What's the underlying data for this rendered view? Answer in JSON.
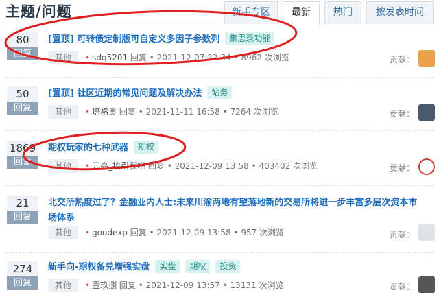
{
  "header": {
    "title": "主题/问题",
    "tabs": [
      {
        "label": "新手专区",
        "active": false
      },
      {
        "label": "最新",
        "active": true
      },
      {
        "label": "热门",
        "active": false
      },
      {
        "label": "按发表时间",
        "active": false
      }
    ]
  },
  "labels": {
    "reply": "回复",
    "contrib": "贡献：",
    "views_suffix": "次浏览",
    "reply_word": "回复"
  },
  "posts": [
    {
      "count": "80",
      "title": "[置顶] 可转债定制版可自定义多因子参数列",
      "tags": [
        "集思录功能"
      ],
      "category": "其他",
      "author": "sdq5201",
      "time": "2021-12-07 22:34",
      "views": "8962",
      "avatar_color": "#e9a14b"
    },
    {
      "count": "50",
      "title": "[置顶] 社区近期的常见问题及解决办法",
      "tags": [
        "站务"
      ],
      "category": "其他",
      "author": "塔格奥",
      "time": "2021-11-11 16:58",
      "views": "7264",
      "avatar_color": "#4a5a6a"
    },
    {
      "count": "1869",
      "title": "期权玩家的七种武器",
      "tags": [
        "期权"
      ],
      "category": "其他",
      "author": "元亮_搞引我吧",
      "time": "2021-12-09 13:58",
      "views": "403402",
      "avatar_color": "#cf3b3b"
    },
    {
      "count": "21",
      "title": "北交所热度过了？金融业内人士:未来川渝两地有望落地新的交易所将进一步丰富多层次资本市场体系",
      "tags": [],
      "category": "其他",
      "author": "goodexp",
      "time": "2021-12-09 13:58",
      "views": "957",
      "avatar_color": "#dfe3e6"
    },
    {
      "count": "274",
      "title": "新手向-期权备兑增强实盘",
      "tags": [
        "实盘",
        "期权",
        "投资"
      ],
      "category": "其他",
      "author": "壹玖捌",
      "time": "2021-12-09 13:57",
      "views": "13131",
      "avatar_color": "#555555"
    }
  ],
  "colors": {
    "accent": "#1f6fbf",
    "tag_bg": "#d7f2f0",
    "tag_text": "#1e8b83",
    "annotation": "#e02020"
  }
}
